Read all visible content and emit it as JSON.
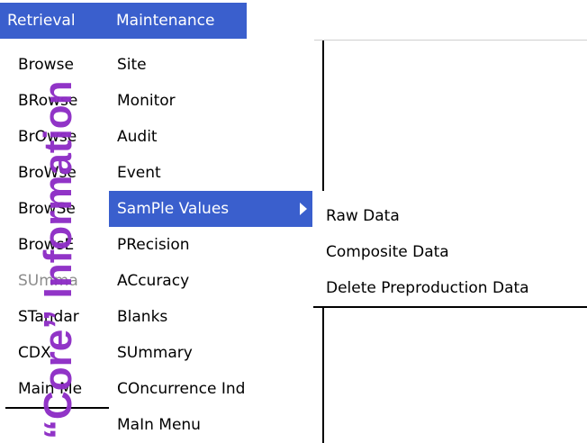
{
  "menubar": {
    "retrieval": "Retrieval",
    "maintenance": "Maintenance"
  },
  "retrieval_menu": {
    "items": [
      "Browse",
      "BRowse",
      "BrOwse",
      "BroWse",
      "BrowSe",
      "BrowsE",
      "SUmma",
      "STandar",
      "CDX",
      "Main Me"
    ]
  },
  "maintenance_menu": {
    "items": [
      "Site",
      "Monitor",
      "Audit",
      "Event",
      "SamPle Values",
      "PRecision",
      "ACcuracy",
      "Blanks",
      "SUmmary",
      "COncurrence Ind",
      "MaIn Menu"
    ],
    "selected": "SamPle Values"
  },
  "sample_values_menu": {
    "items": [
      "Raw Data",
      "Composite Data",
      "Delete Preproduction Data"
    ]
  },
  "side_title": "“Core” Information",
  "colors": {
    "menu_highlight": "#3a5fcd",
    "title_purple": "#8e2ec6",
    "disabled_text": "#8c8c8c"
  }
}
